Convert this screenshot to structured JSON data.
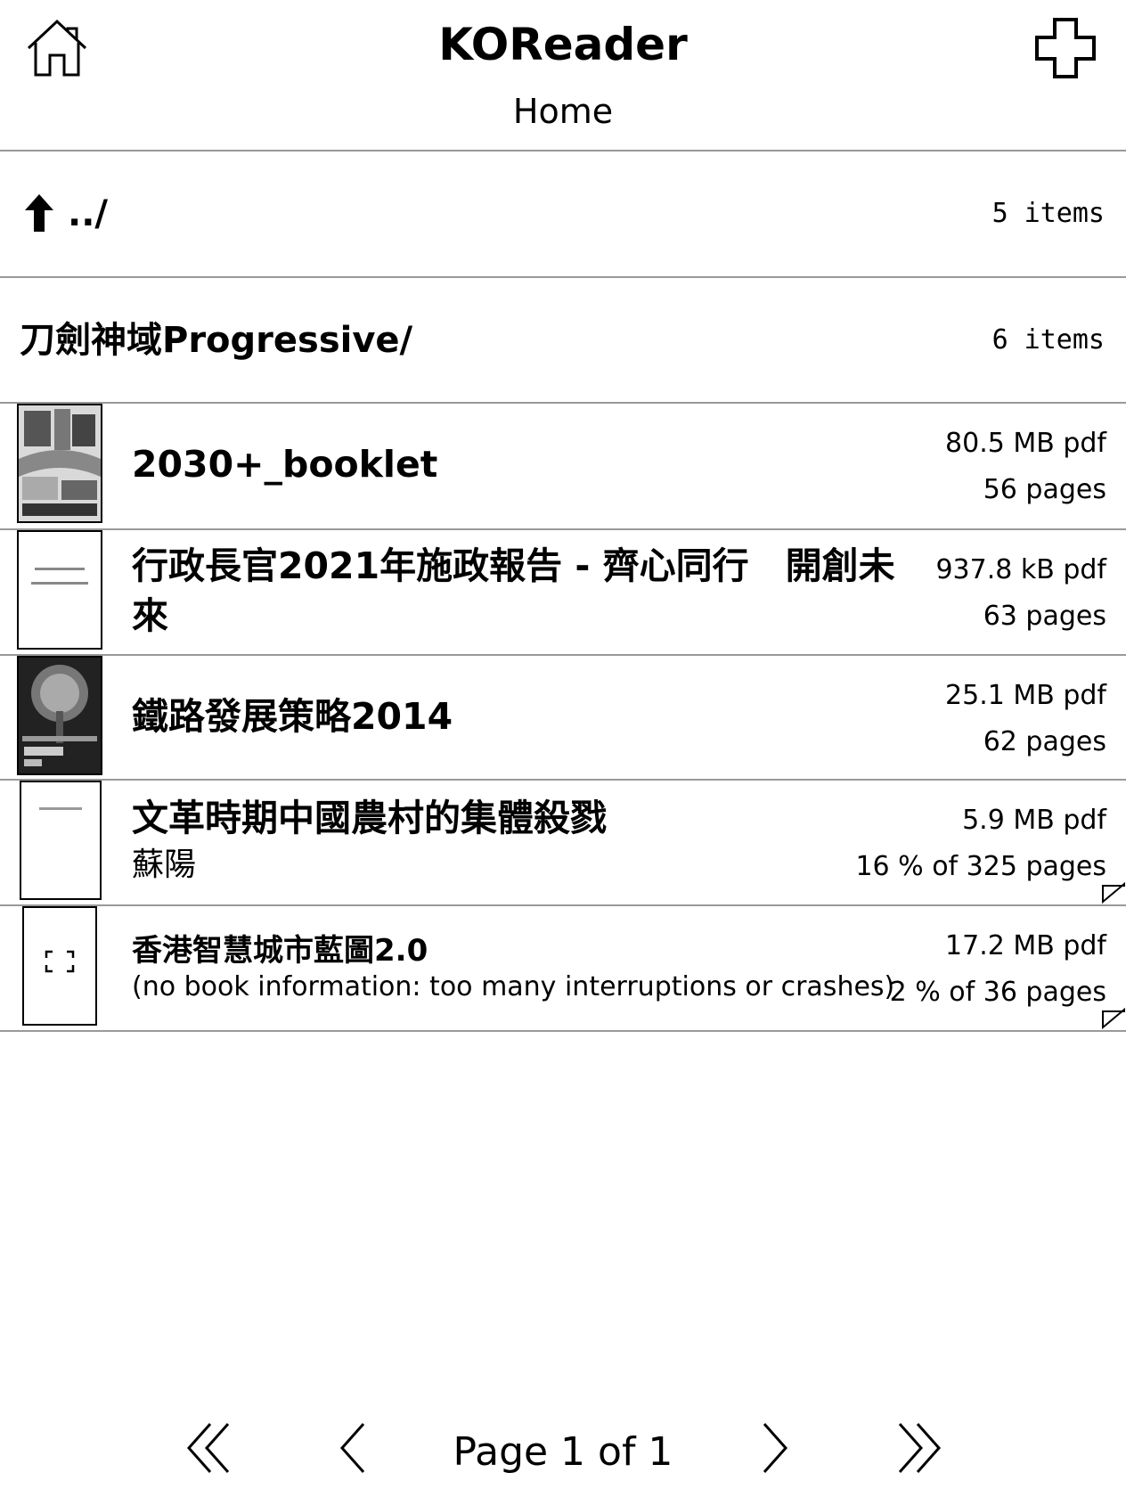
{
  "header": {
    "title": "KOReader",
    "subtitle": "Home",
    "home_icon": "home-icon",
    "plus_icon": "plus-icon"
  },
  "list": {
    "parent": {
      "name": "../",
      "count": "5 items",
      "icon": "up-arrow-icon"
    },
    "folders": [
      {
        "name": "刀劍神域Progressive/",
        "count": "6 items"
      }
    ],
    "books": [
      {
        "title": "2030+_booklet",
        "author": "",
        "size": "80.5 MB  pdf",
        "pages": "56 pages"
      },
      {
        "title": "行政長官2021年施政報告 - 齊心同行　開創未來",
        "author": "",
        "size": "937.8 kB  pdf",
        "pages": "63 pages"
      },
      {
        "title": "鐵路發展策略2014",
        "author": "",
        "size": "25.1 MB  pdf",
        "pages": "62 pages"
      },
      {
        "title": "文革時期中國農村的集體殺戮",
        "author": "蘇陽",
        "size": "5.9 MB  pdf",
        "pages": "16 % of 325 pages"
      },
      {
        "title": "香港智慧城市藍圖2.0",
        "author": "(no book information: too many interruptions or crashes)",
        "size": "17.2 MB  pdf",
        "pages": "2 % of 36 pages"
      }
    ]
  },
  "footer": {
    "page_label": "Page 1 of 1",
    "first_icon": "first-page-icon",
    "prev_icon": "prev-page-icon",
    "next_icon": "next-page-icon",
    "last_icon": "last-page-icon"
  }
}
